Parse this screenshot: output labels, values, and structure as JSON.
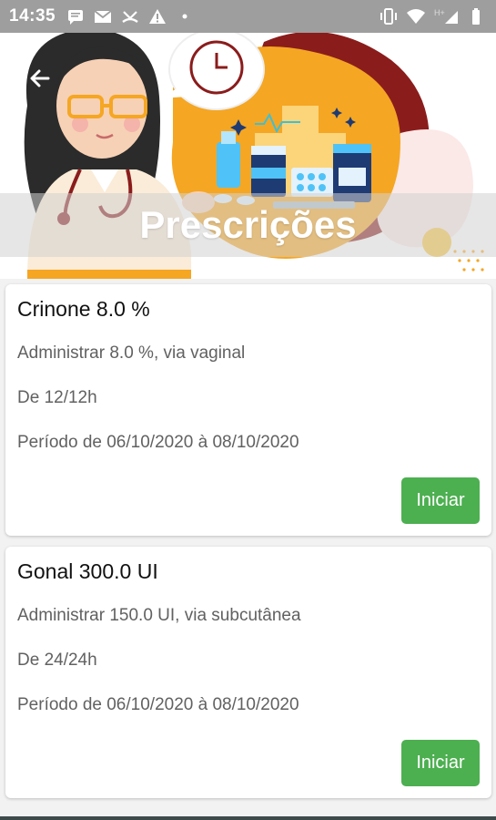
{
  "status_bar": {
    "time": "14:35",
    "left_icons": [
      "message-icon",
      "mail-icon",
      "missed-call-icon",
      "alert-icon",
      "dot-icon"
    ],
    "right_icons": [
      "vibrate-icon",
      "wifi-icon",
      "signal-icon",
      "battery-icon"
    ],
    "network_label": "H+"
  },
  "header": {
    "title": "Prescrições",
    "back_icon": "arrow-back-icon",
    "illustration": "doctor-and-medicine-illustration"
  },
  "prescriptions": [
    {
      "name": "Crinone 8.0 %",
      "dosage": "Administrar 8.0 %, via vaginal",
      "frequency": "De 12/12h",
      "period": "Período de 06/10/2020  à 08/10/2020",
      "action_label": "Iniciar"
    },
    {
      "name": "Gonal 300.0 UI",
      "dosage": "Administrar 150.0 UI, via subcutânea",
      "frequency": "De 24/24h",
      "period": "Período de 06/10/2020  à 08/10/2020",
      "action_label": "Iniciar"
    }
  ],
  "colors": {
    "accent_green": "#4caf50",
    "banner_orange": "#f5a623",
    "banner_dark_red": "#8b1c1c",
    "status_bar": "#9e9e9e"
  }
}
